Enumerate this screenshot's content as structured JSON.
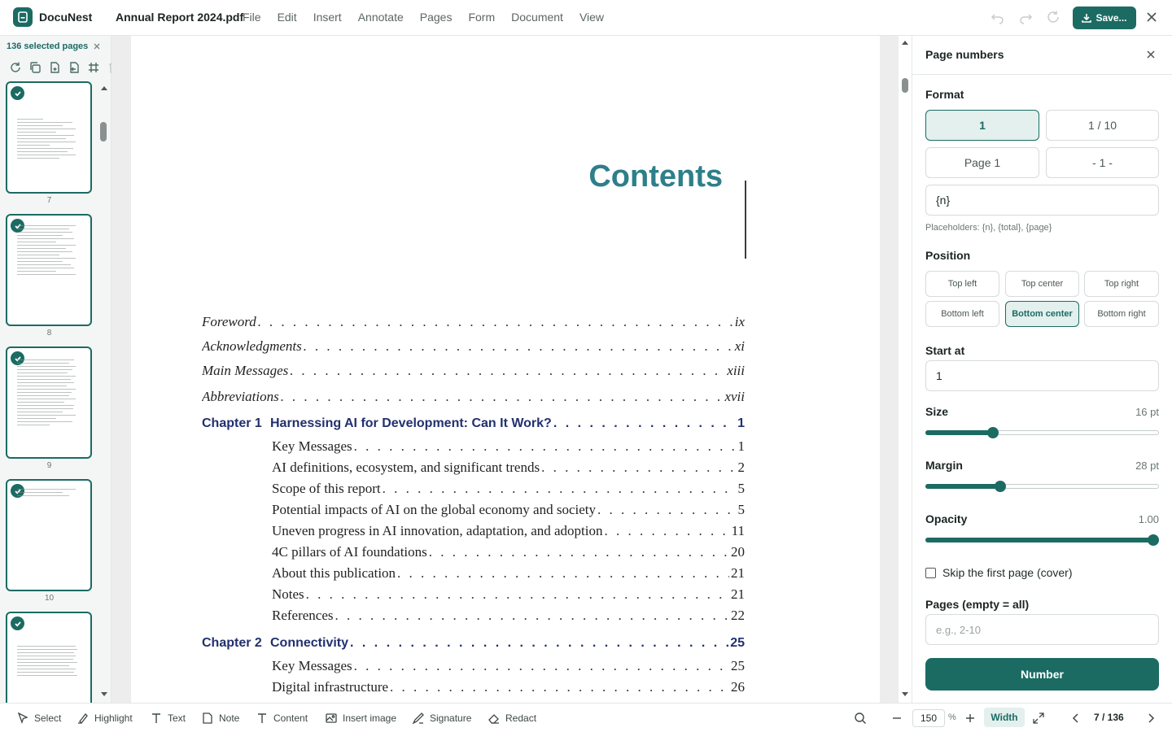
{
  "app": {
    "brand": "DocuNest",
    "document_title": "Annual Report 2024.pdf",
    "menu": [
      "File",
      "Edit",
      "Insert",
      "Annotate",
      "Pages",
      "Form",
      "Document",
      "View"
    ],
    "save_label": "Save...",
    "icons": [
      "undo-icon",
      "redo-icon",
      "refresh-icon",
      "download-icon",
      "close-icon"
    ]
  },
  "sidebar": {
    "selection_label": "136 selected pages",
    "tools": [
      "rotate-icon",
      "copy-icon",
      "duplicate-icon",
      "extract-icon",
      "grid-icon",
      "delete-icon"
    ],
    "thumbnails": [
      {
        "number": "7",
        "selected": true
      },
      {
        "number": "8",
        "selected": true
      },
      {
        "number": "9",
        "selected": true
      },
      {
        "number": "10",
        "selected": true
      },
      {
        "number": "",
        "selected": true
      }
    ]
  },
  "document": {
    "heading": "Contents",
    "toc": [
      {
        "title": "Foreword",
        "page": "ix",
        "style": "italic"
      },
      {
        "title": "Acknowledgments",
        "page": "xi",
        "style": "italic"
      },
      {
        "title": "Main Messages",
        "page": "xiii",
        "style": "italic"
      },
      {
        "title": "Abbreviations",
        "page": "xvii",
        "style": "italic"
      },
      {
        "chapter": "Chapter 1",
        "title": "Harnessing AI for Development: Can It Work?",
        "page": "1",
        "style": "chapter"
      },
      {
        "title": "Key Messages",
        "page": "1",
        "style": "sub"
      },
      {
        "title": "AI definitions, ecosystem, and significant trends",
        "page": "2",
        "style": "sub"
      },
      {
        "title": "Scope of this report",
        "page": "5",
        "style": "sub"
      },
      {
        "title": "Potential impacts of AI on the global economy and society",
        "page": "5",
        "style": "sub"
      },
      {
        "title": "Uneven progress in AI innovation, adaptation, and adoption",
        "page": "11",
        "style": "sub"
      },
      {
        "title": "4C pillars of AI foundations",
        "page": "20",
        "style": "sub"
      },
      {
        "title": "About this publication",
        "page": "21",
        "style": "sub"
      },
      {
        "title": "Notes",
        "page": "21",
        "style": "sub"
      },
      {
        "title": "References",
        "page": "22",
        "style": "sub"
      },
      {
        "chapter": "Chapter 2",
        "title": "Connectivity",
        "page": "25",
        "style": "chapter"
      },
      {
        "title": "Key Messages",
        "page": "25",
        "style": "sub"
      },
      {
        "title": "Digital infrastructure",
        "page": "26",
        "style": "sub"
      }
    ]
  },
  "panel": {
    "title": "Page numbers",
    "format_label": "Format",
    "format_options": [
      "1",
      "1 / 10",
      "Page 1",
      "- 1 -"
    ],
    "format_selected": "1",
    "template_value": "{n}",
    "placeholders_hint": "Placeholders: {n}, {total}, {page}",
    "position_label": "Position",
    "position_options": [
      "Top left",
      "Top center",
      "Top right",
      "Bottom left",
      "Bottom center",
      "Bottom right"
    ],
    "position_selected": "Bottom center",
    "start_label": "Start at",
    "start_value": "1",
    "size_label": "Size",
    "size_value": "16 pt",
    "size_fraction": 0.29,
    "margin_label": "Margin",
    "margin_value": "28 pt",
    "margin_fraction": 0.32,
    "opacity_label": "Opacity",
    "opacity_value": "1.00",
    "opacity_fraction": 1.0,
    "skip_label": "Skip the first page (cover)",
    "skip_checked": false,
    "pages_label": "Pages (empty = all)",
    "pages_placeholder": "e.g., 2-10",
    "submit_label": "Number"
  },
  "bottombar": {
    "tools": [
      {
        "label": "Select",
        "icon": "cursor-icon"
      },
      {
        "label": "Highlight",
        "icon": "highlighter-icon"
      },
      {
        "label": "Text",
        "icon": "text-icon"
      },
      {
        "label": "Note",
        "icon": "note-icon"
      },
      {
        "label": "Content",
        "icon": "text-icon"
      },
      {
        "label": "Insert image",
        "icon": "image-icon"
      },
      {
        "label": "Signature",
        "icon": "signature-icon"
      },
      {
        "label": "Redact",
        "icon": "eraser-icon"
      }
    ],
    "zoom_value": "150",
    "zoom_unit": "%",
    "fit_label": "Width",
    "page_indicator": "7 / 136"
  },
  "colors": {
    "accent": "#1b6b63",
    "accent_light": "#e3f0ee",
    "heading_teal": "#2d7f8a",
    "chapter_navy": "#22306e"
  }
}
